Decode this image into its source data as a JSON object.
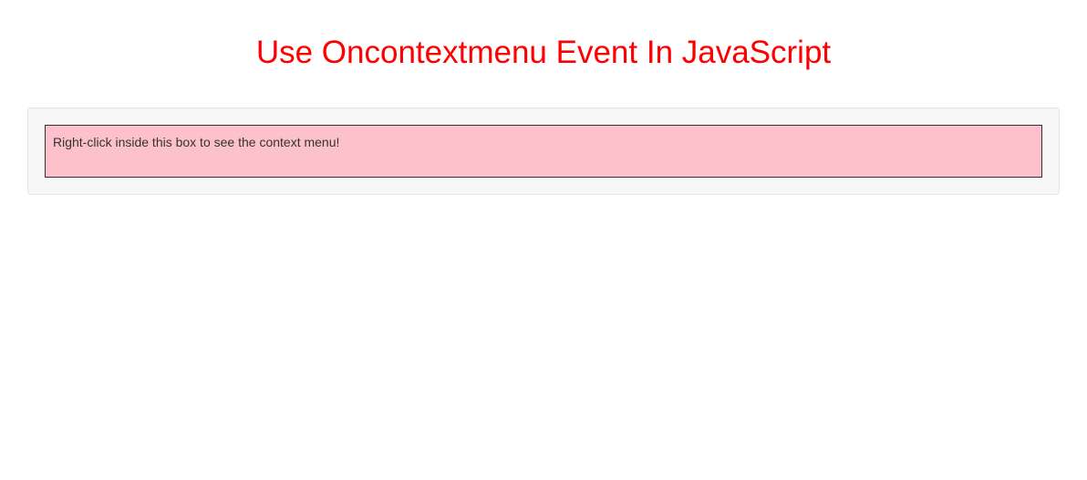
{
  "heading": "Use Oncontextmenu Event In JavaScript",
  "instruction": "Right-click inside this box to see the context menu!"
}
